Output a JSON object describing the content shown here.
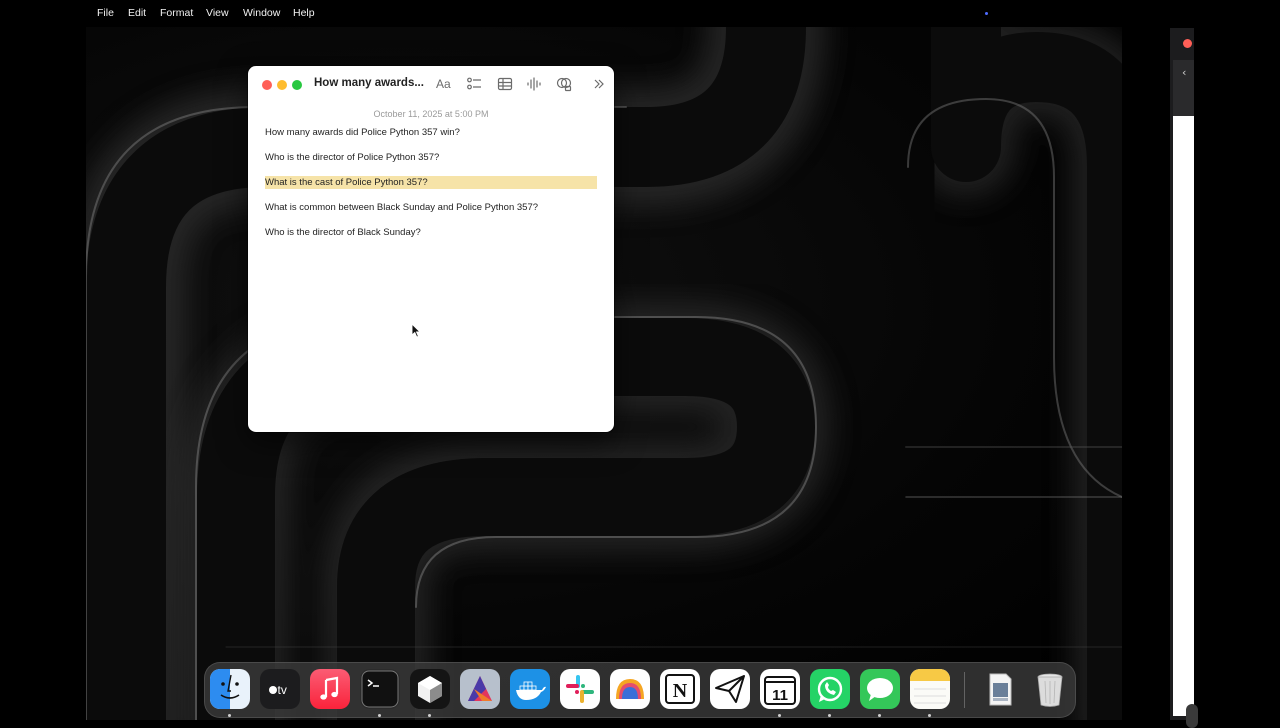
{
  "menubar": {
    "items": [
      "File",
      "Edit",
      "Format",
      "View",
      "Window",
      "Help"
    ]
  },
  "notes": {
    "title": "How many awards...",
    "font_button": "Aa",
    "date": "October 11, 2025 at 5:00 PM",
    "lines": [
      "How many awards did Police Python 357 win?",
      "Who is the director of Police Python 357?",
      "What is the cast of Police Python 357?",
      "What is common between Black Sunday and Police Python 357?",
      "Who is the director of Black Sunday?"
    ],
    "highlighted_line_index": 2,
    "highlight_color": "#f6e3a8"
  },
  "dock": {
    "apps": [
      "finder-icon",
      "apple-tv-icon",
      "music-icon",
      "terminal-icon",
      "cube-app-icon",
      "affinity-icon",
      "docker-icon",
      "slack-icon",
      "arc-icon",
      "notion-icon",
      "paper-plane-icon",
      "calendar-icon",
      "whatsapp-icon",
      "messages-icon",
      "notes-icon",
      "document-preview-icon",
      "trash-icon"
    ],
    "calendar_day": "11",
    "tv_label": "tv",
    "notion_letter": "N"
  },
  "colors": {
    "close": "#ff5f57",
    "minimize": "#febc2e",
    "maximize": "#28c840"
  }
}
